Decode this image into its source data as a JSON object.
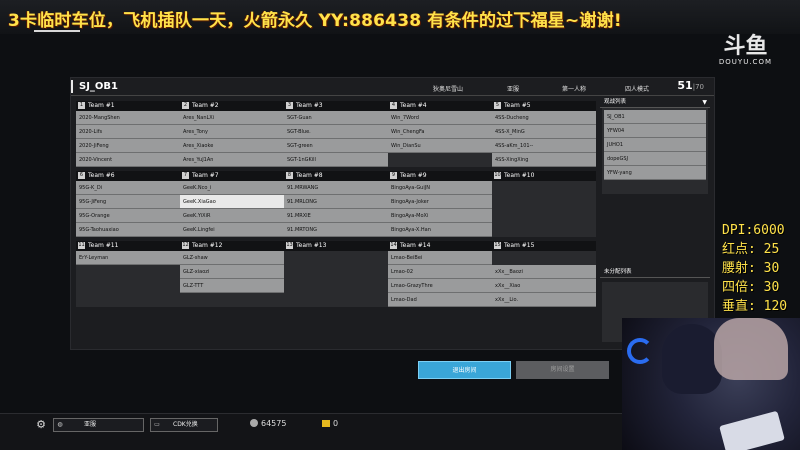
{
  "overlay": {
    "banner": "3卡临时车位，飞机插队一天，火箭永久 YY:886438 有条件的过下福星~谢谢!",
    "logo_main": "斗鱼",
    "logo_sub": "DOUYU.COM",
    "stats": [
      "DPI:6000",
      "红点: 25",
      "腰射: 30",
      "四倍: 30",
      "垂直: 120"
    ]
  },
  "room": {
    "name": "SJ_OB1",
    "map": "狄奥尼雪山",
    "server": "亚服",
    "perspective": "第一人称",
    "mode": "四人模式",
    "current": "51",
    "max": "70"
  },
  "teams": [
    {
      "label": "Team #1",
      "num": "1",
      "players": [
        "2020-MangShen",
        "2020-Lifs",
        "2020-JiFeng",
        "2020-Vincent"
      ]
    },
    {
      "label": "Team #2",
      "num": "2",
      "players": [
        "Ares_NanLXi",
        "Ares_Tony",
        "Ares_Xiaoke",
        "Ares_YuJ1An"
      ]
    },
    {
      "label": "Team #3",
      "num": "3",
      "players": [
        "SGT-Guan",
        "SGT-Blue.",
        "SGT-green",
        "SGT-1nGKill"
      ]
    },
    {
      "label": "Team #4",
      "num": "4",
      "players": [
        "Win_7Word",
        "Win_ChengFa",
        "Win_DianSu",
        ""
      ]
    },
    {
      "label": "Team #5",
      "num": "5",
      "players": [
        "4SS-Ducheng",
        "4SS-X_MinG",
        "4SS-aKm_101--",
        "4SS-XingXing"
      ]
    },
    {
      "label": "Team #6",
      "num": "6",
      "players": [
        "95G-K_Di",
        "95G-JiFeng",
        "95G-Orange",
        "95G-Taohuaxiao"
      ]
    },
    {
      "label": "Team #7",
      "num": "7",
      "players": [
        "GeeK.Nco_i",
        "GeeK.XiaGao",
        "GeeK.YiXiR",
        "GeeK.Lingfei"
      ]
    },
    {
      "label": "Team #8",
      "num": "8",
      "players": [
        "91.MRWANG",
        "91.MRLONG",
        "91.MRXIE",
        "91.MRTONG"
      ]
    },
    {
      "label": "Team #9",
      "num": "9",
      "players": [
        "BingoAya-GuiJN",
        "BingoAya-Joker",
        "BingoAya-MoXi",
        "BingoAya-X.Han"
      ]
    },
    {
      "label": "Team #10",
      "num": "10",
      "players": [
        "",
        "",
        "",
        ""
      ]
    },
    {
      "label": "Team #11",
      "num": "11",
      "players": [
        "ErY-Leyman",
        "",
        "",
        ""
      ]
    },
    {
      "label": "Team #12",
      "num": "12",
      "players": [
        "GLZ-shaw",
        "GLZ-xiaozi",
        "GLZ-TTT",
        ""
      ]
    },
    {
      "label": "Team #13",
      "num": "13",
      "players": [
        "",
        "",
        "",
        ""
      ]
    },
    {
      "label": "Team #14",
      "num": "14",
      "players": [
        "Lmao-BeiBei",
        "Lmao-02",
        "Lmao-GrazyThre",
        "Lmao-Dad"
      ]
    },
    {
      "label": "Team #15",
      "num": "15",
      "players": [
        "",
        "xXx__Baozi",
        "xXx__Xiao",
        "xXx__Lio."
      ]
    }
  ],
  "selected_slot": "GeeK.XiaGao",
  "observers": {
    "title": "观战列表",
    "list": [
      "SJ_OB1",
      "YFW04",
      "JUHO1",
      "dopeGSJ",
      "YFW-yang"
    ]
  },
  "unassigned": {
    "title": "未分配列表"
  },
  "buttons": {
    "exit": "退出房间",
    "settings": "房间设置"
  },
  "bottom": {
    "server": "亚服",
    "cdk": "CDK兑换",
    "coins": "64575",
    "gold": "0"
  }
}
